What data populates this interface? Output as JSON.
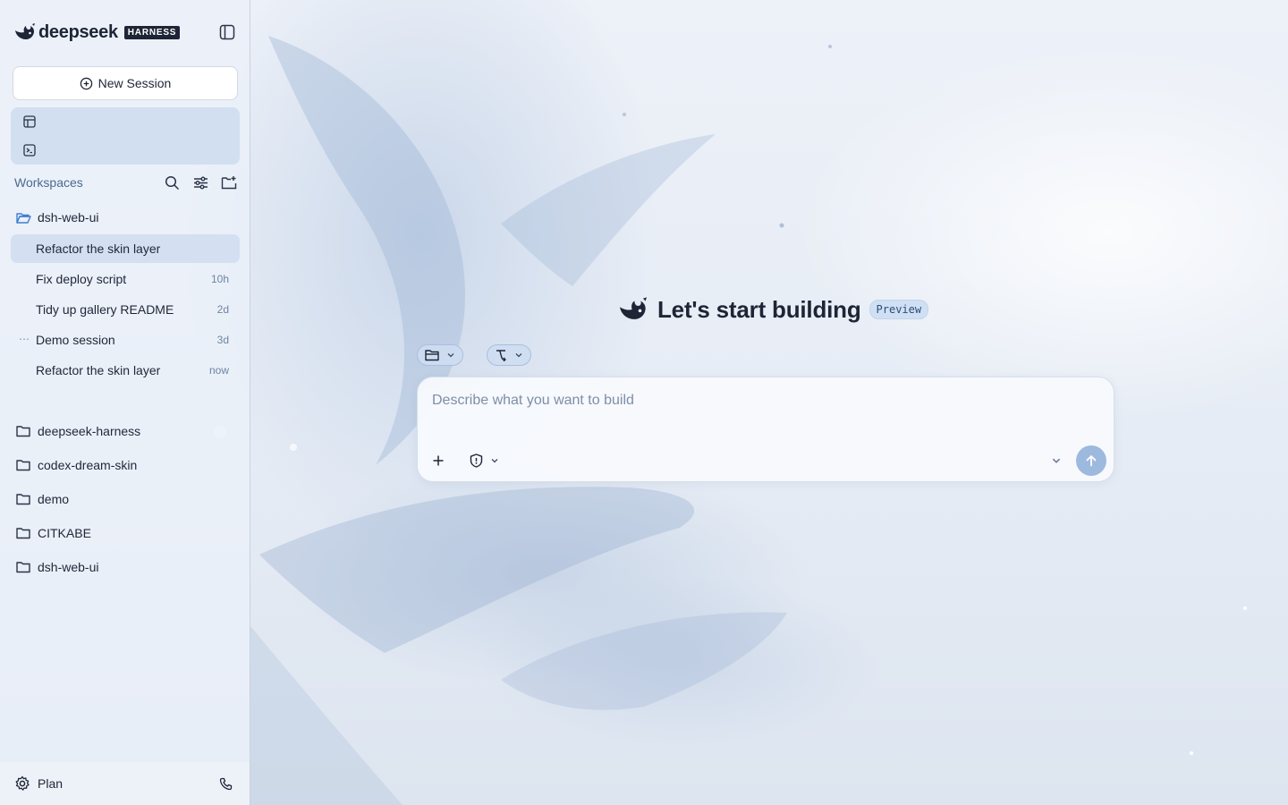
{
  "brand": {
    "name": "deepseek",
    "badge": "HARNESS",
    "logo_icon": "deepseek-whale-logo"
  },
  "toolbar": {
    "collapse_icon": "sidebar-toggle-icon"
  },
  "new_session": {
    "label": "New Session",
    "icon": "plus-circle-icon"
  },
  "quick_nav": [
    {
      "icon": "layout-icon"
    },
    {
      "icon": "terminal-icon"
    }
  ],
  "workspaces": {
    "title": "Workspaces",
    "tools": [
      "search-icon",
      "filter-sliders-icon",
      "new-folder-icon"
    ],
    "open_folder": {
      "name": "dsh-web-ui",
      "sessions": [
        {
          "title": "Refactor the skin layer",
          "time": "",
          "active": true
        },
        {
          "title": "Fix deploy script",
          "time": "10h"
        },
        {
          "title": "Tidy up gallery README",
          "time": "2d"
        },
        {
          "title": "Demo session",
          "time": "3d",
          "running": true
        },
        {
          "title": "Refactor the skin layer",
          "time": "now"
        }
      ]
    },
    "folders": [
      {
        "name": "deepseek-harness"
      },
      {
        "name": "codex-dream-skin"
      },
      {
        "name": "demo"
      },
      {
        "name": "CITKABE"
      },
      {
        "name": "dsh-web-ui"
      }
    ]
  },
  "footer": {
    "plan_label": "Plan",
    "settings_icon": "gear-icon",
    "phone_icon": "phone-icon"
  },
  "hero": {
    "title": "Let's start building",
    "badge": "Preview"
  },
  "chips": [
    {
      "icon": "folder-icon"
    },
    {
      "icon": "git-branch-icon"
    }
  ],
  "composer": {
    "placeholder": "Describe what you want to build",
    "value": "",
    "add_icon": "plus-icon",
    "permission_icon": "shield-icon",
    "send_icon": "arrow-up-icon"
  },
  "colors": {
    "accent": "#9db9de",
    "sidebar_active": "#d2def0",
    "text_primary": "#1d2536",
    "text_muted": "#6e84a3",
    "folder_open": "#3f7fd0"
  }
}
